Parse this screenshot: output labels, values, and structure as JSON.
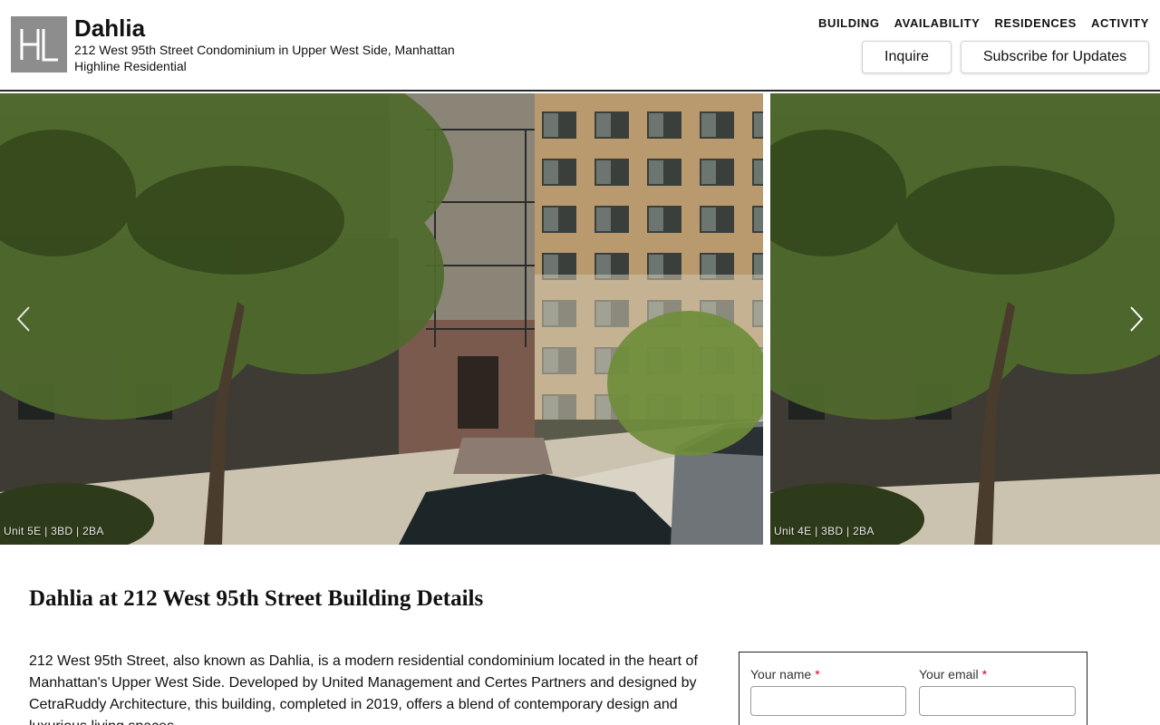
{
  "header": {
    "logo_text": "HL",
    "title": "Dahlia",
    "subtitle": "212 West 95th Street Condominium in Upper West Side, Manhattan",
    "developer": "Highline Residential",
    "nav": [
      "BUILDING",
      "AVAILABILITY",
      "RESIDENCES",
      "ACTIVITY"
    ],
    "inquire_label": "Inquire",
    "subscribe_label": "Subscribe for Updates"
  },
  "gallery": {
    "slides": [
      {
        "caption": "Unit  5E  |  3BD  |  2BA"
      },
      {
        "caption": "Unit  4E  |  3BD  |  2BA"
      }
    ]
  },
  "content": {
    "title": "Dahlia at 212 West 95th Street Building Details",
    "description": "212 West 95th Street, also known as Dahlia, is a modern residential condominium located in the heart of Manhattan's Upper West Side. Developed by United Management and Certes Partners and designed by CetraRuddy Architecture, this building, completed in 2019, offers a blend of contemporary design and luxurious living spaces."
  },
  "form": {
    "name_label": "Your name",
    "email_label": "Your email",
    "required_mark": "*",
    "name_value": "",
    "email_value": ""
  }
}
